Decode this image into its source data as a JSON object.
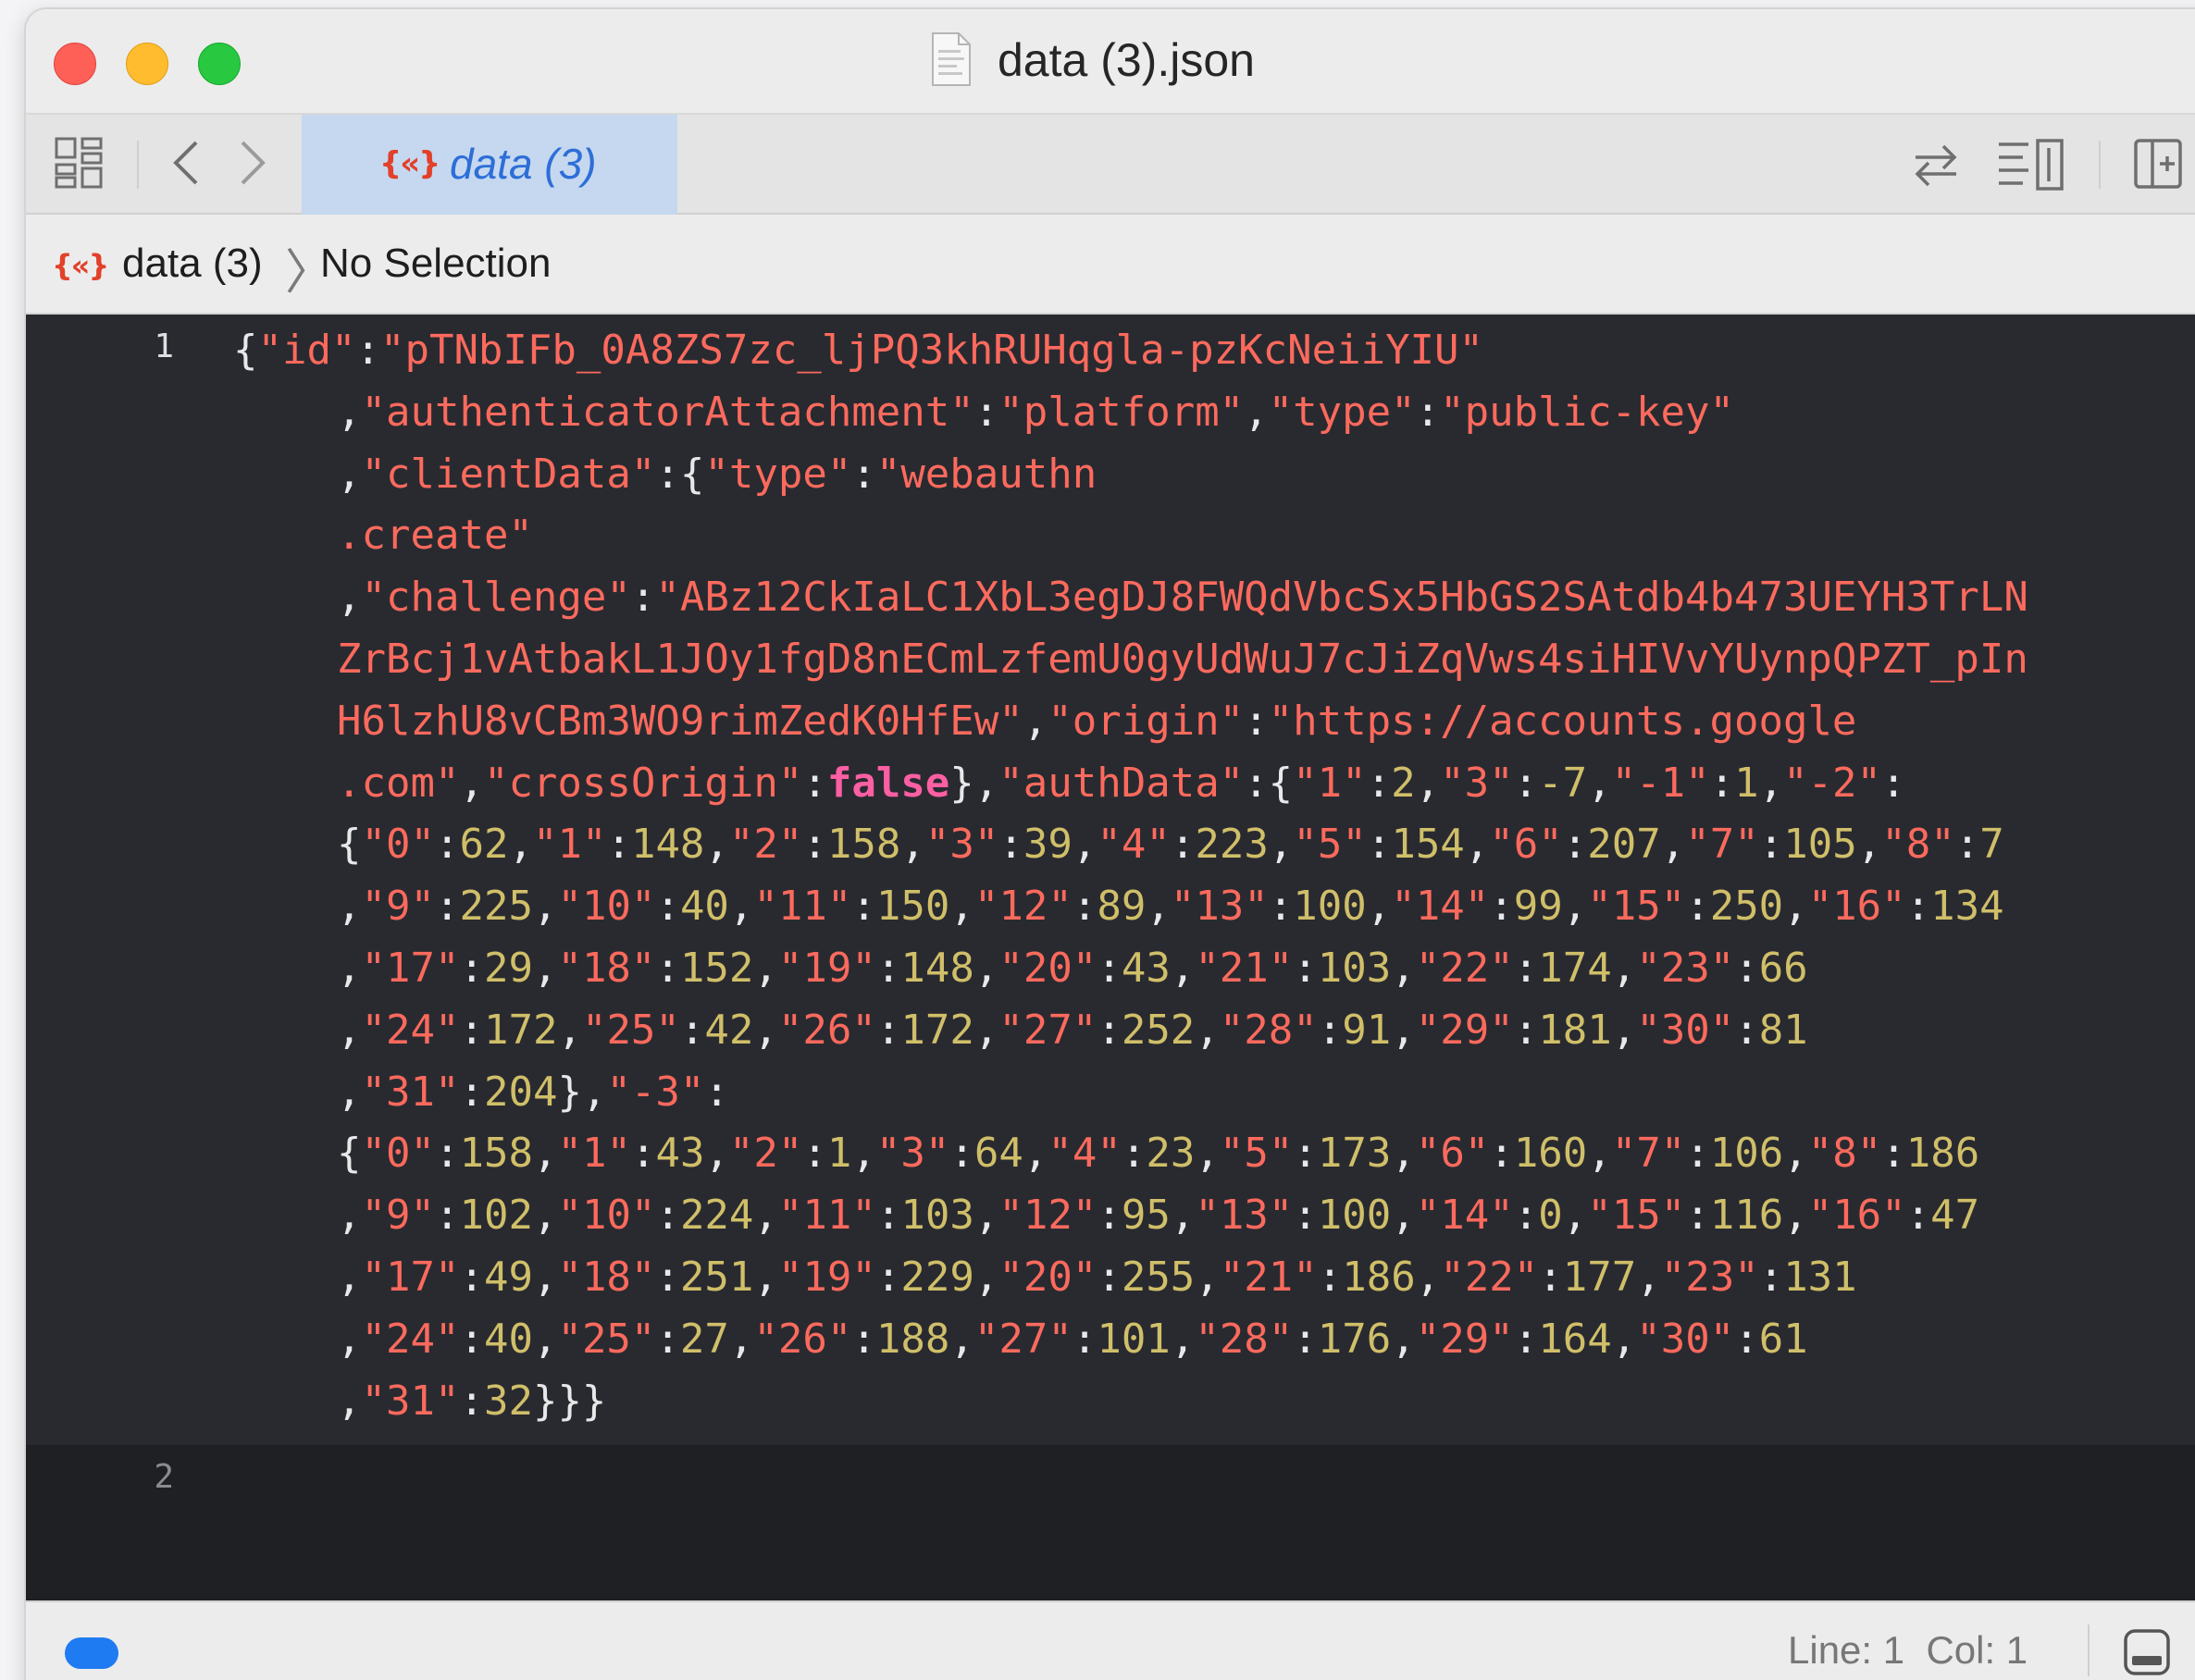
{
  "window": {
    "title": "data (3).json"
  },
  "tabbar": {
    "active_tab_icon": "{«}",
    "active_tab_label": "data (3)"
  },
  "jumpbar": {
    "file_icon": "{«}",
    "file_label": "data (3)",
    "separator": "〉",
    "selection_label": "No Selection"
  },
  "editor": {
    "line_numbers": [
      "1",
      "2"
    ],
    "lines": [
      [
        [
          "p",
          "{"
        ],
        [
          "s",
          "\"id\""
        ],
        [
          "p",
          ":"
        ],
        [
          "s",
          "\"pTNbIFb_0A8ZS7zc_ljPQ3khRUHqgla-pzKcNeiiYIU\""
        ]
      ],
      [
        [
          "p",
          ","
        ],
        [
          "s",
          "\"authenticatorAttachment\""
        ],
        [
          "p",
          ":"
        ],
        [
          "s",
          "\"platform\""
        ],
        [
          "p",
          ","
        ],
        [
          "s",
          "\"type\""
        ],
        [
          "p",
          ":"
        ],
        [
          "s",
          "\"public-key\""
        ]
      ],
      [
        [
          "p",
          ","
        ],
        [
          "s",
          "\"clientData\""
        ],
        [
          "p",
          ":{"
        ],
        [
          "s",
          "\"type\""
        ],
        [
          "p",
          ":"
        ],
        [
          "s",
          "\"webauthn"
        ]
      ],
      [
        [
          "s",
          ".create\""
        ]
      ],
      [
        [
          "p",
          ","
        ],
        [
          "s",
          "\"challenge\""
        ],
        [
          "p",
          ":"
        ],
        [
          "s",
          "\"ABz12CkIaLC1XbL3egDJ8FWQdVbcSx5HbGS2SAtdb4b473UEYH3TrLN"
        ]
      ],
      [
        [
          "s",
          "ZrBcj1vAtbakL1JOy1fgD8nECmLzfemU0gyUdWuJ7cJiZqVws4siHIVvYUynpQPZT_pIn"
        ]
      ],
      [
        [
          "s",
          "H6lzhU8vCBm3WO9rimZedK0HfEw\""
        ],
        [
          "p",
          ","
        ],
        [
          "s",
          "\"origin\""
        ],
        [
          "p",
          ":"
        ],
        [
          "s",
          "\"https://accounts.google"
        ]
      ],
      [
        [
          "s",
          ".com\""
        ],
        [
          "p",
          ","
        ],
        [
          "s",
          "\"crossOrigin\""
        ],
        [
          "p",
          ":"
        ],
        [
          "k",
          "false"
        ],
        [
          "p",
          "},"
        ],
        [
          "s",
          "\"authData\""
        ],
        [
          "p",
          ":{"
        ],
        [
          "s",
          "\"1\""
        ],
        [
          "p",
          ":"
        ],
        [
          "n",
          "2"
        ],
        [
          "p",
          ","
        ],
        [
          "s",
          "\"3\""
        ],
        [
          "p",
          ":"
        ],
        [
          "n",
          "-7"
        ],
        [
          "p",
          ","
        ],
        [
          "s",
          "\"-1\""
        ],
        [
          "p",
          ":"
        ],
        [
          "n",
          "1"
        ],
        [
          "p",
          ","
        ],
        [
          "s",
          "\"-2\""
        ],
        [
          "p",
          ":"
        ]
      ],
      [
        [
          "p",
          "{"
        ],
        [
          "s",
          "\"0\""
        ],
        [
          "p",
          ":"
        ],
        [
          "n",
          "62"
        ],
        [
          "p",
          ","
        ],
        [
          "s",
          "\"1\""
        ],
        [
          "p",
          ":"
        ],
        [
          "n",
          "148"
        ],
        [
          "p",
          ","
        ],
        [
          "s",
          "\"2\""
        ],
        [
          "p",
          ":"
        ],
        [
          "n",
          "158"
        ],
        [
          "p",
          ","
        ],
        [
          "s",
          "\"3\""
        ],
        [
          "p",
          ":"
        ],
        [
          "n",
          "39"
        ],
        [
          "p",
          ","
        ],
        [
          "s",
          "\"4\""
        ],
        [
          "p",
          ":"
        ],
        [
          "n",
          "223"
        ],
        [
          "p",
          ","
        ],
        [
          "s",
          "\"5\""
        ],
        [
          "p",
          ":"
        ],
        [
          "n",
          "154"
        ],
        [
          "p",
          ","
        ],
        [
          "s",
          "\"6\""
        ],
        [
          "p",
          ":"
        ],
        [
          "n",
          "207"
        ],
        [
          "p",
          ","
        ],
        [
          "s",
          "\"7\""
        ],
        [
          "p",
          ":"
        ],
        [
          "n",
          "105"
        ],
        [
          "p",
          ","
        ],
        [
          "s",
          "\"8\""
        ],
        [
          "p",
          ":"
        ],
        [
          "n",
          "7"
        ]
      ],
      [
        [
          "p",
          ","
        ],
        [
          "s",
          "\"9\""
        ],
        [
          "p",
          ":"
        ],
        [
          "n",
          "225"
        ],
        [
          "p",
          ","
        ],
        [
          "s",
          "\"10\""
        ],
        [
          "p",
          ":"
        ],
        [
          "n",
          "40"
        ],
        [
          "p",
          ","
        ],
        [
          "s",
          "\"11\""
        ],
        [
          "p",
          ":"
        ],
        [
          "n",
          "150"
        ],
        [
          "p",
          ","
        ],
        [
          "s",
          "\"12\""
        ],
        [
          "p",
          ":"
        ],
        [
          "n",
          "89"
        ],
        [
          "p",
          ","
        ],
        [
          "s",
          "\"13\""
        ],
        [
          "p",
          ":"
        ],
        [
          "n",
          "100"
        ],
        [
          "p",
          ","
        ],
        [
          "s",
          "\"14\""
        ],
        [
          "p",
          ":"
        ],
        [
          "n",
          "99"
        ],
        [
          "p",
          ","
        ],
        [
          "s",
          "\"15\""
        ],
        [
          "p",
          ":"
        ],
        [
          "n",
          "250"
        ],
        [
          "p",
          ","
        ],
        [
          "s",
          "\"16\""
        ],
        [
          "p",
          ":"
        ],
        [
          "n",
          "134"
        ]
      ],
      [
        [
          "p",
          ","
        ],
        [
          "s",
          "\"17\""
        ],
        [
          "p",
          ":"
        ],
        [
          "n",
          "29"
        ],
        [
          "p",
          ","
        ],
        [
          "s",
          "\"18\""
        ],
        [
          "p",
          ":"
        ],
        [
          "n",
          "152"
        ],
        [
          "p",
          ","
        ],
        [
          "s",
          "\"19\""
        ],
        [
          "p",
          ":"
        ],
        [
          "n",
          "148"
        ],
        [
          "p",
          ","
        ],
        [
          "s",
          "\"20\""
        ],
        [
          "p",
          ":"
        ],
        [
          "n",
          "43"
        ],
        [
          "p",
          ","
        ],
        [
          "s",
          "\"21\""
        ],
        [
          "p",
          ":"
        ],
        [
          "n",
          "103"
        ],
        [
          "p",
          ","
        ],
        [
          "s",
          "\"22\""
        ],
        [
          "p",
          ":"
        ],
        [
          "n",
          "174"
        ],
        [
          "p",
          ","
        ],
        [
          "s",
          "\"23\""
        ],
        [
          "p",
          ":"
        ],
        [
          "n",
          "66"
        ]
      ],
      [
        [
          "p",
          ","
        ],
        [
          "s",
          "\"24\""
        ],
        [
          "p",
          ":"
        ],
        [
          "n",
          "172"
        ],
        [
          "p",
          ","
        ],
        [
          "s",
          "\"25\""
        ],
        [
          "p",
          ":"
        ],
        [
          "n",
          "42"
        ],
        [
          "p",
          ","
        ],
        [
          "s",
          "\"26\""
        ],
        [
          "p",
          ":"
        ],
        [
          "n",
          "172"
        ],
        [
          "p",
          ","
        ],
        [
          "s",
          "\"27\""
        ],
        [
          "p",
          ":"
        ],
        [
          "n",
          "252"
        ],
        [
          "p",
          ","
        ],
        [
          "s",
          "\"28\""
        ],
        [
          "p",
          ":"
        ],
        [
          "n",
          "91"
        ],
        [
          "p",
          ","
        ],
        [
          "s",
          "\"29\""
        ],
        [
          "p",
          ":"
        ],
        [
          "n",
          "181"
        ],
        [
          "p",
          ","
        ],
        [
          "s",
          "\"30\""
        ],
        [
          "p",
          ":"
        ],
        [
          "n",
          "81"
        ]
      ],
      [
        [
          "p",
          ","
        ],
        [
          "s",
          "\"31\""
        ],
        [
          "p",
          ":"
        ],
        [
          "n",
          "204"
        ],
        [
          "p",
          "},"
        ],
        [
          "s",
          "\"-3\""
        ],
        [
          "p",
          ":"
        ]
      ],
      [
        [
          "p",
          "{"
        ],
        [
          "s",
          "\"0\""
        ],
        [
          "p",
          ":"
        ],
        [
          "n",
          "158"
        ],
        [
          "p",
          ","
        ],
        [
          "s",
          "\"1\""
        ],
        [
          "p",
          ":"
        ],
        [
          "n",
          "43"
        ],
        [
          "p",
          ","
        ],
        [
          "s",
          "\"2\""
        ],
        [
          "p",
          ":"
        ],
        [
          "n",
          "1"
        ],
        [
          "p",
          ","
        ],
        [
          "s",
          "\"3\""
        ],
        [
          "p",
          ":"
        ],
        [
          "n",
          "64"
        ],
        [
          "p",
          ","
        ],
        [
          "s",
          "\"4\""
        ],
        [
          "p",
          ":"
        ],
        [
          "n",
          "23"
        ],
        [
          "p",
          ","
        ],
        [
          "s",
          "\"5\""
        ],
        [
          "p",
          ":"
        ],
        [
          "n",
          "173"
        ],
        [
          "p",
          ","
        ],
        [
          "s",
          "\"6\""
        ],
        [
          "p",
          ":"
        ],
        [
          "n",
          "160"
        ],
        [
          "p",
          ","
        ],
        [
          "s",
          "\"7\""
        ],
        [
          "p",
          ":"
        ],
        [
          "n",
          "106"
        ],
        [
          "p",
          ","
        ],
        [
          "s",
          "\"8\""
        ],
        [
          "p",
          ":"
        ],
        [
          "n",
          "186"
        ]
      ],
      [
        [
          "p",
          ","
        ],
        [
          "s",
          "\"9\""
        ],
        [
          "p",
          ":"
        ],
        [
          "n",
          "102"
        ],
        [
          "p",
          ","
        ],
        [
          "s",
          "\"10\""
        ],
        [
          "p",
          ":"
        ],
        [
          "n",
          "224"
        ],
        [
          "p",
          ","
        ],
        [
          "s",
          "\"11\""
        ],
        [
          "p",
          ":"
        ],
        [
          "n",
          "103"
        ],
        [
          "p",
          ","
        ],
        [
          "s",
          "\"12\""
        ],
        [
          "p",
          ":"
        ],
        [
          "n",
          "95"
        ],
        [
          "p",
          ","
        ],
        [
          "s",
          "\"13\""
        ],
        [
          "p",
          ":"
        ],
        [
          "n",
          "100"
        ],
        [
          "p",
          ","
        ],
        [
          "s",
          "\"14\""
        ],
        [
          "p",
          ":"
        ],
        [
          "n",
          "0"
        ],
        [
          "p",
          ","
        ],
        [
          "s",
          "\"15\""
        ],
        [
          "p",
          ":"
        ],
        [
          "n",
          "116"
        ],
        [
          "p",
          ","
        ],
        [
          "s",
          "\"16\""
        ],
        [
          "p",
          ":"
        ],
        [
          "n",
          "47"
        ]
      ],
      [
        [
          "p",
          ","
        ],
        [
          "s",
          "\"17\""
        ],
        [
          "p",
          ":"
        ],
        [
          "n",
          "49"
        ],
        [
          "p",
          ","
        ],
        [
          "s",
          "\"18\""
        ],
        [
          "p",
          ":"
        ],
        [
          "n",
          "251"
        ],
        [
          "p",
          ","
        ],
        [
          "s",
          "\"19\""
        ],
        [
          "p",
          ":"
        ],
        [
          "n",
          "229"
        ],
        [
          "p",
          ","
        ],
        [
          "s",
          "\"20\""
        ],
        [
          "p",
          ":"
        ],
        [
          "n",
          "255"
        ],
        [
          "p",
          ","
        ],
        [
          "s",
          "\"21\""
        ],
        [
          "p",
          ":"
        ],
        [
          "n",
          "186"
        ],
        [
          "p",
          ","
        ],
        [
          "s",
          "\"22\""
        ],
        [
          "p",
          ":"
        ],
        [
          "n",
          "177"
        ],
        [
          "p",
          ","
        ],
        [
          "s",
          "\"23\""
        ],
        [
          "p",
          ":"
        ],
        [
          "n",
          "131"
        ]
      ],
      [
        [
          "p",
          ","
        ],
        [
          "s",
          "\"24\""
        ],
        [
          "p",
          ":"
        ],
        [
          "n",
          "40"
        ],
        [
          "p",
          ","
        ],
        [
          "s",
          "\"25\""
        ],
        [
          "p",
          ":"
        ],
        [
          "n",
          "27"
        ],
        [
          "p",
          ","
        ],
        [
          "s",
          "\"26\""
        ],
        [
          "p",
          ":"
        ],
        [
          "n",
          "188"
        ],
        [
          "p",
          ","
        ],
        [
          "s",
          "\"27\""
        ],
        [
          "p",
          ":"
        ],
        [
          "n",
          "101"
        ],
        [
          "p",
          ","
        ],
        [
          "s",
          "\"28\""
        ],
        [
          "p",
          ":"
        ],
        [
          "n",
          "176"
        ],
        [
          "p",
          ","
        ],
        [
          "s",
          "\"29\""
        ],
        [
          "p",
          ":"
        ],
        [
          "n",
          "164"
        ],
        [
          "p",
          ","
        ],
        [
          "s",
          "\"30\""
        ],
        [
          "p",
          ":"
        ],
        [
          "n",
          "61"
        ]
      ],
      [
        [
          "p",
          ","
        ],
        [
          "s",
          "\"31\""
        ],
        [
          "p",
          ":"
        ],
        [
          "n",
          "32"
        ],
        [
          "p",
          "}}}"
        ]
      ]
    ]
  },
  "statusbar": {
    "cursor_position": "Line: 1  Col: 1"
  },
  "colors": {
    "editor_background": "#292a30",
    "string": "#fc6a5d",
    "number": "#d0bf69",
    "keyword": "#fc5fa3",
    "active_tab": "#c5d8ef",
    "status_accent": "#1f7bf2"
  },
  "icons": {
    "titlebar": "json-document-icon",
    "tabbar_left": [
      "grid-icon",
      "back-chevron-icon",
      "forward-chevron-icon"
    ],
    "tabbar_right": [
      "swap-arrows-icon",
      "minimap-icon",
      "add-editor-icon"
    ],
    "statusbar_right": "toggle-panel-icon"
  }
}
